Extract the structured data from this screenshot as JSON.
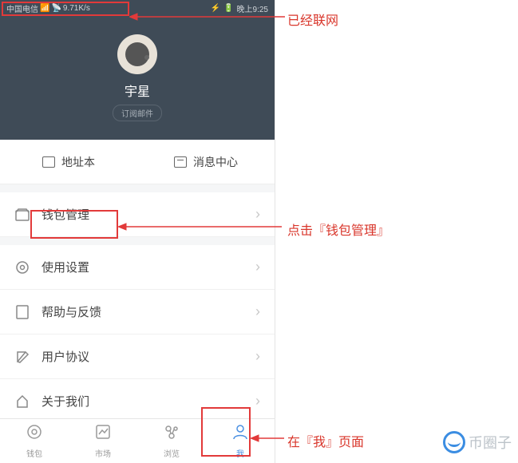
{
  "status": {
    "carrier": "中国电信",
    "speed": "9.71K/s",
    "time": "晚上9:25"
  },
  "profile": {
    "username": "宇星",
    "subscribe": "订阅邮件"
  },
  "quick": {
    "address_book": "地址本",
    "message_center": "消息中心"
  },
  "menu": {
    "wallet": "钱包管理",
    "settings": "使用设置",
    "help": "帮助与反馈",
    "agreement": "用户协议",
    "about": "关于我们"
  },
  "nav": {
    "wallet": "钱包",
    "market": "市场",
    "browse": "浏览",
    "me": "我"
  },
  "annotations": {
    "networked": "已经联网",
    "click_wallet": "点击『钱包管理』",
    "on_me_page": "在『我』页面"
  },
  "watermark": "币圈子"
}
